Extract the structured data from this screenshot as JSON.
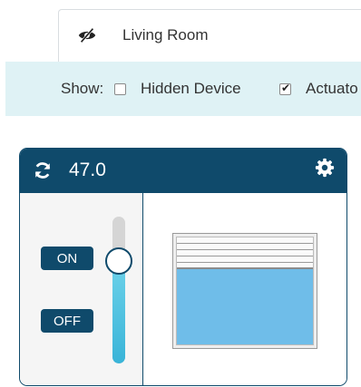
{
  "tab": {
    "label": "Living Room",
    "icon": "eye-slash-icon"
  },
  "filter": {
    "show_label": "Show:",
    "options": [
      {
        "label": "Hidden Device",
        "checked": false
      },
      {
        "label": "Actuato",
        "checked": true
      }
    ]
  },
  "device": {
    "value": "47.0",
    "refresh_icon": "refresh-icon",
    "settings_icon": "gear-icon",
    "on_label": "ON",
    "off_label": "OFF",
    "slider_level": 0.7,
    "shutter_closed_fraction": 0.3
  },
  "colors": {
    "header": "#0f4a6b",
    "filter_bg": "#dff2f5",
    "slider_fill": "#39b4d8",
    "glass": "#6fbde9"
  }
}
